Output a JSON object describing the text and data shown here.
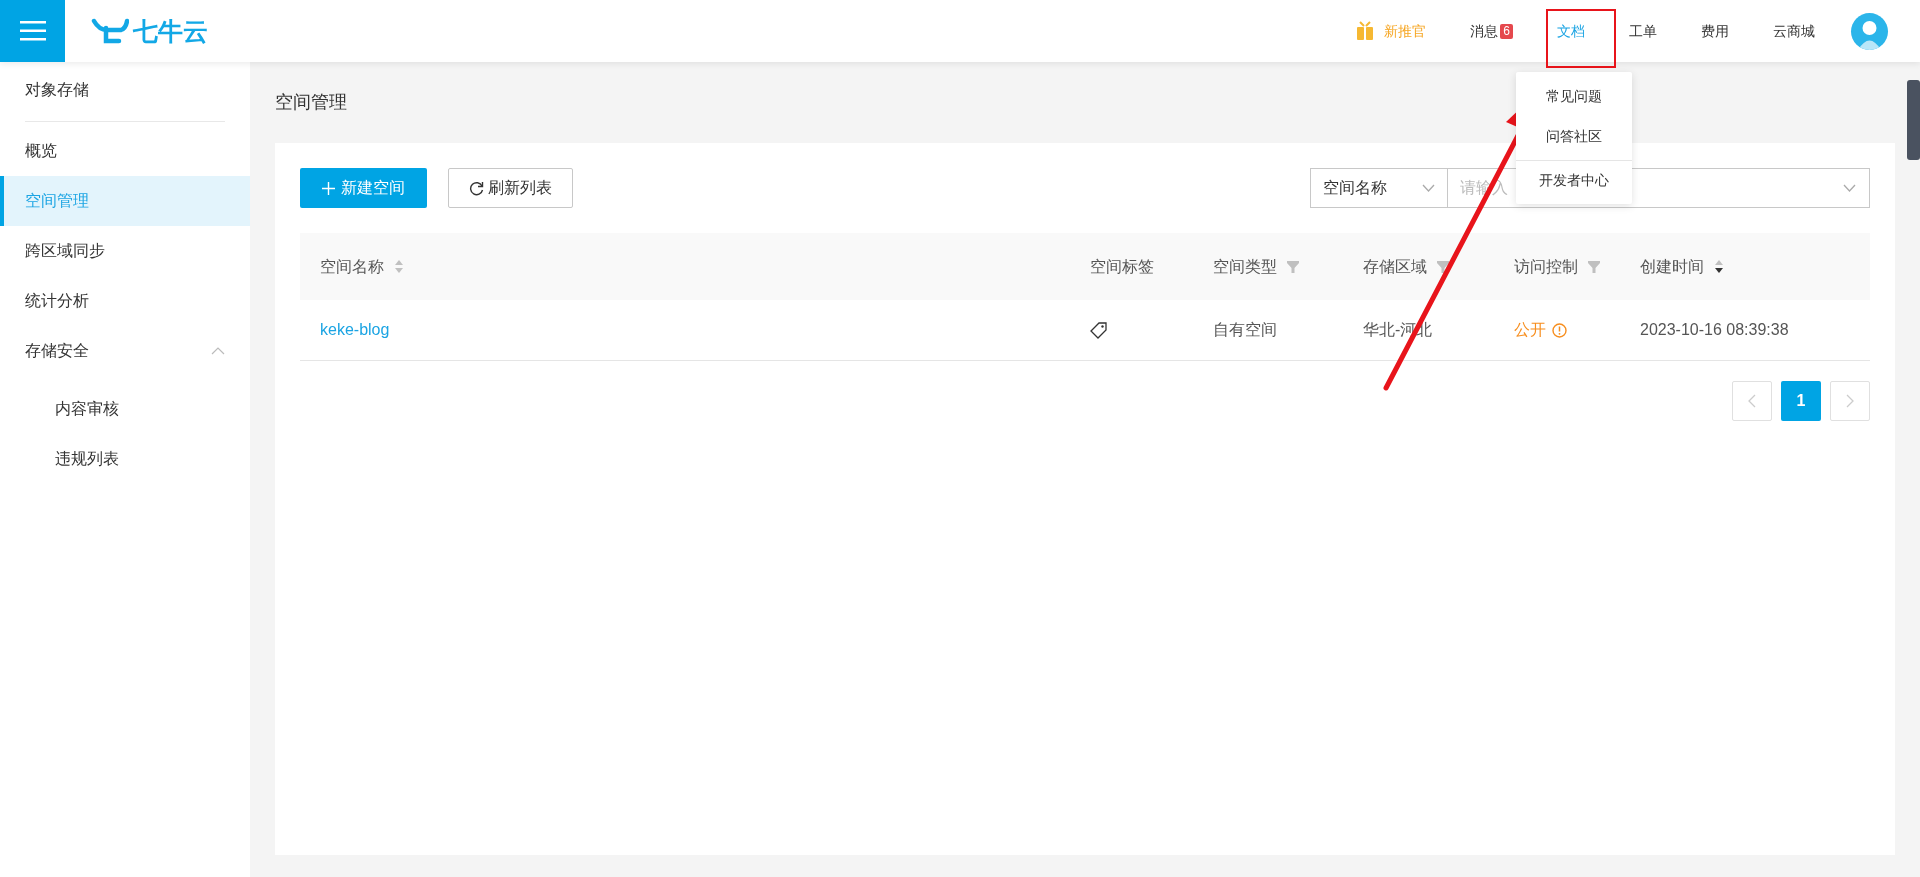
{
  "topbar": {
    "logo": "七牛云",
    "nav": [
      {
        "label": "新推官",
        "kind": "promo",
        "selected": false
      },
      {
        "label": "消息",
        "kind": "badge",
        "badge": "6",
        "selected": false
      },
      {
        "label": "文档",
        "kind": "plain",
        "selected": true
      },
      {
        "label": "工单",
        "kind": "plain",
        "selected": false
      },
      {
        "label": "费用",
        "kind": "plain",
        "selected": false
      },
      {
        "label": "云商城",
        "kind": "plain",
        "selected": false
      }
    ]
  },
  "docs_menu": {
    "items": [
      {
        "label": "常见问题",
        "divider_before": false
      },
      {
        "label": "问答社区",
        "divider_before": false
      },
      {
        "label": "开发者中心",
        "divider_before": true
      }
    ]
  },
  "sidebar": {
    "heading": "对象存储",
    "items": [
      {
        "label": "概览",
        "selected": false
      },
      {
        "label": "空间管理",
        "selected": true
      },
      {
        "label": "跨区域同步",
        "selected": false
      },
      {
        "label": "统计分析",
        "selected": false
      },
      {
        "label": "存储安全",
        "selected": false,
        "expanded": true,
        "children": [
          {
            "label": "内容审核",
            "selected": false
          },
          {
            "label": "违规列表",
            "selected": false
          }
        ]
      }
    ]
  },
  "page_title": "空间管理",
  "toolbar": {
    "create_button": "新建空间",
    "refresh_button": "刷新列表",
    "search": {
      "field_select": "空间名称",
      "placeholder": "请输入"
    }
  },
  "table": {
    "columns": [
      {
        "label": "空间名称",
        "kind": "sort",
        "sorted_descending": false
      },
      {
        "label": "空间标签",
        "kind": "plain"
      },
      {
        "label": "空间类型",
        "kind": "filter"
      },
      {
        "label": "存储区域",
        "kind": "filter"
      },
      {
        "label": "访问控制",
        "kind": "filter"
      },
      {
        "label": "创建时间",
        "kind": "sort",
        "sorted_descending": true
      }
    ],
    "rows": [
      {
        "name": "keke-blog",
        "type": "自有空间",
        "region": "华北-河北",
        "access": "公开",
        "created": "2023-10-16 08:39:38"
      }
    ]
  },
  "pagination": {
    "pages": [
      {
        "label": "1",
        "selected": true
      }
    ]
  }
}
